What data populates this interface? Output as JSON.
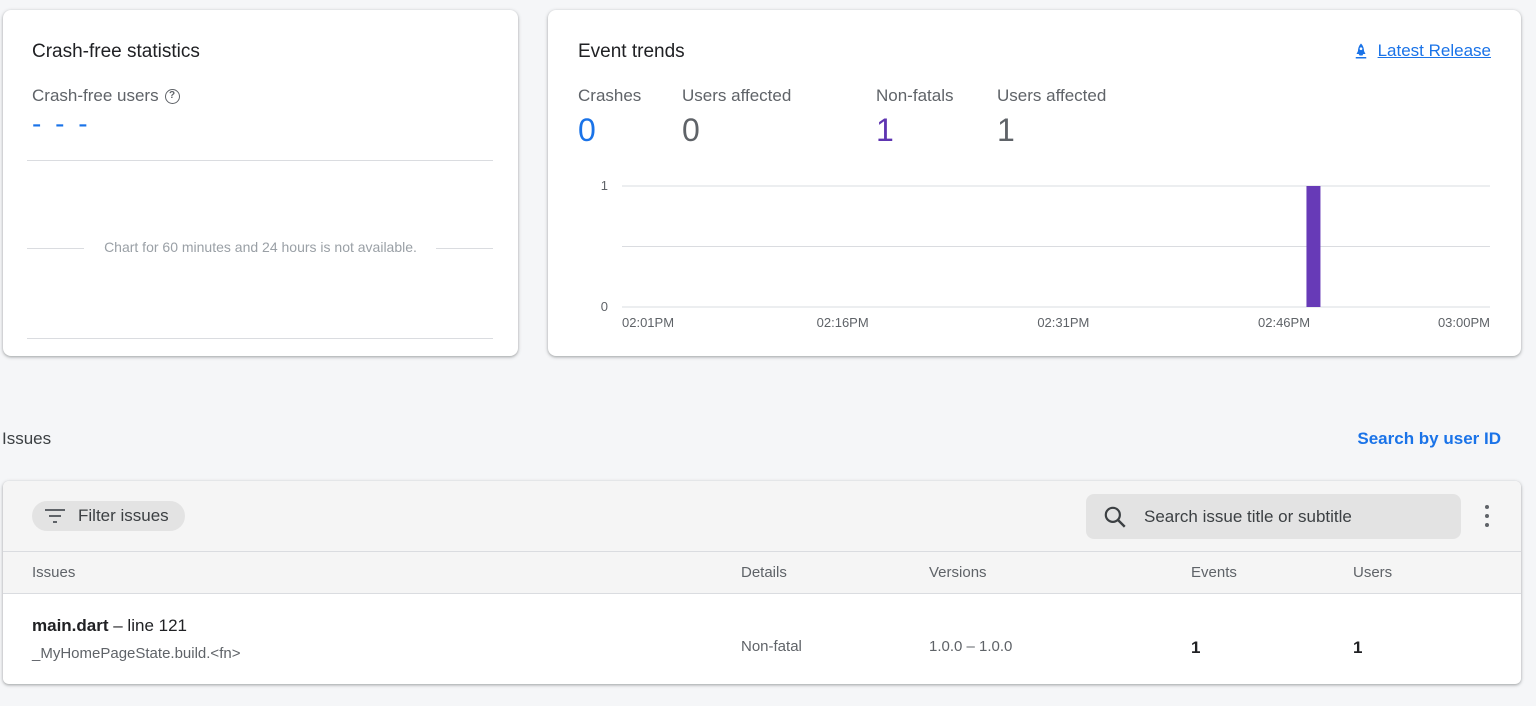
{
  "crash_free": {
    "title": "Crash-free statistics",
    "subtitle": "Crash-free users",
    "value": "- - -",
    "unavailable": "Chart for 60 minutes and 24 hours is not available."
  },
  "trends": {
    "title": "Event trends",
    "release_link": "Latest Release",
    "stats": [
      {
        "label": "Crashes",
        "value": "0"
      },
      {
        "label": "Users affected",
        "value": "0"
      },
      {
        "label": "Non-fatals",
        "value": "1"
      },
      {
        "label": "Users affected",
        "value": "1"
      }
    ]
  },
  "chart_data": {
    "type": "bar",
    "x_ticks": [
      "02:01PM",
      "02:16PM",
      "02:31PM",
      "02:46PM",
      "03:00PM"
    ],
    "y_ticks": [
      "0",
      "1"
    ],
    "ylim": [
      0,
      1
    ],
    "series": [
      {
        "values": [
          {
            "x": "02:48PM",
            "y": 1
          }
        ],
        "color": "#673ab7"
      }
    ]
  },
  "issues_section": {
    "label": "Issues",
    "search_by_user": "Search by user ID",
    "filter_label": "Filter issues",
    "search_placeholder": "Search issue title or subtitle",
    "columns": [
      "Issues",
      "Details",
      "Versions",
      "Events",
      "Users"
    ],
    "rows": [
      {
        "file": "main.dart",
        "line": " – line 121",
        "subtitle": "_MyHomePageState.build.<fn>",
        "details": "Non-fatal",
        "versions": "1.0.0 – 1.0.0",
        "events": "1",
        "users": "1"
      }
    ]
  },
  "colors": {
    "accent": "#1a73e8",
    "nonfatal": "#673ab7"
  }
}
